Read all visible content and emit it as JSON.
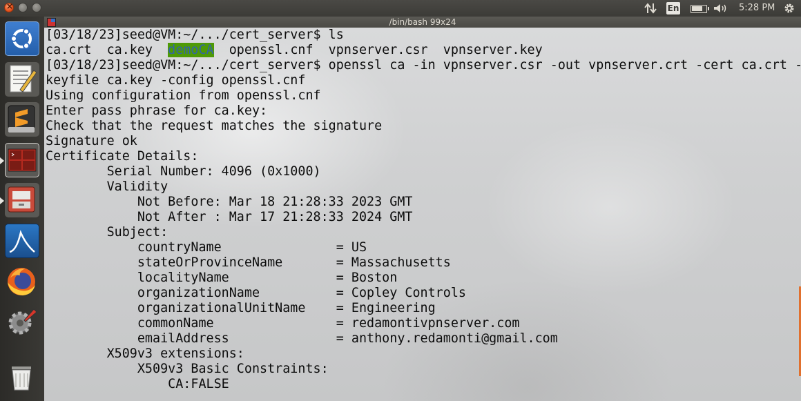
{
  "window": {
    "title": "/bin/bash 99x24"
  },
  "topbar": {
    "language": "En",
    "time": "5:28 PM",
    "battery_level": 0.75
  },
  "launcher": {
    "items": [
      {
        "name": "ubuntu-dash-icon"
      },
      {
        "name": "text-editor-icon"
      },
      {
        "name": "sublime-text-icon"
      },
      {
        "name": "terminal-icon"
      },
      {
        "name": "file-manager-icon"
      },
      {
        "name": "wireshark-icon"
      },
      {
        "name": "firefox-icon"
      },
      {
        "name": "system-settings-icon"
      },
      {
        "name": "trash-icon"
      }
    ]
  },
  "terminal": {
    "lines": [
      {
        "pre": "[03/18/23]seed@VM:~/.../cert_server$ ls"
      },
      {
        "pre": "ca.crt  ca.key  ",
        "hl": "demoCA",
        "post": "  openssl.cnf  vpnserver.csr  vpnserver.key"
      },
      {
        "pre": "[03/18/23]seed@VM:~/.../cert_server$ openssl ca -in vpnserver.csr -out vpnserver.crt -cert ca.crt -"
      },
      {
        "pre": "keyfile ca.key -config openssl.cnf"
      },
      {
        "pre": "Using configuration from openssl.cnf"
      },
      {
        "pre": "Enter pass phrase for ca.key:"
      },
      {
        "pre": "Check that the request matches the signature"
      },
      {
        "pre": "Signature ok"
      },
      {
        "pre": "Certificate Details:"
      },
      {
        "pre": "        Serial Number: 4096 (0x1000)"
      },
      {
        "pre": "        Validity"
      },
      {
        "pre": "            Not Before: Mar 18 21:28:33 2023 GMT"
      },
      {
        "pre": "            Not After : Mar 17 21:28:33 2024 GMT"
      },
      {
        "pre": "        Subject:"
      },
      {
        "pre": "            countryName               = US"
      },
      {
        "pre": "            stateOrProvinceName       = Massachusetts"
      },
      {
        "pre": "            localityName              = Boston"
      },
      {
        "pre": "            organizationName          = Copley Controls"
      },
      {
        "pre": "            organizationalUnitName    = Engineering"
      },
      {
        "pre": "            commonName                = redamontivpnserver.com"
      },
      {
        "pre": "            emailAddress              = anthony.redamonti@gmail.com"
      },
      {
        "pre": "        X509v3 extensions:"
      },
      {
        "pre": "            X509v3 Basic Constraints:"
      },
      {
        "pre": "                CA:FALSE"
      }
    ]
  }
}
